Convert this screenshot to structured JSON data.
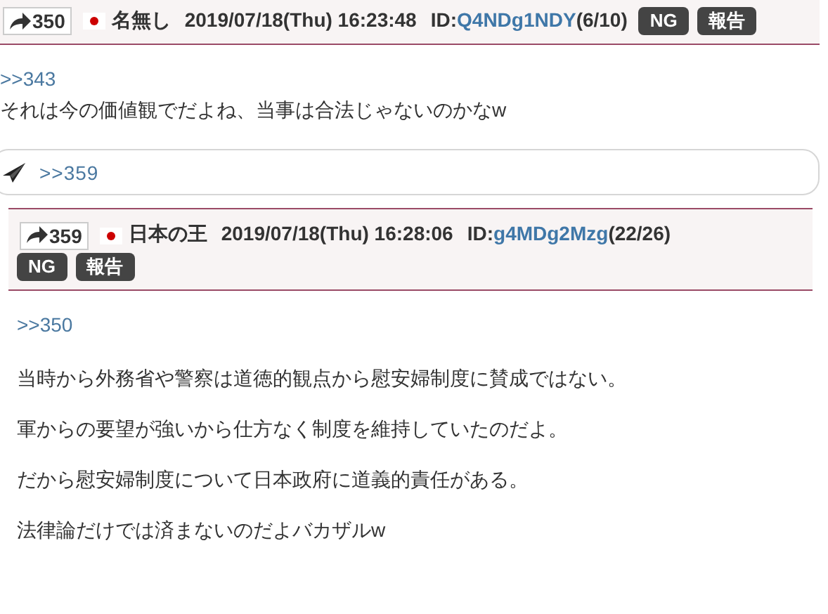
{
  "post": {
    "number": "350",
    "name": "名無し",
    "date": "2019/07/18(Thu) 16:23:48",
    "id_label": "ID:",
    "id": "Q4NDg1NDY",
    "count": "(6/10)",
    "buttons": [
      "NG",
      "報告"
    ],
    "anchor": ">>343",
    "lines": [
      "それは今の価値観でだよね、当事は合法じゃないのかなw"
    ]
  },
  "reply_box": {
    "value": ">>359"
  },
  "quoted_post": {
    "number": "359",
    "name": "日本の王",
    "date": "2019/07/18(Thu) 16:28:06",
    "id_label": "ID:",
    "id": "g4MDg2Mzg",
    "count": "(22/26)",
    "buttons": [
      "NG",
      "報告"
    ],
    "anchor": ">>350",
    "lines": [
      "当時から外務省や警察は道徳的観点から慰安婦制度に賛成ではない。",
      "軍からの要望が強いから仕方なく制度を維持していたのだよ。",
      "だから慰安婦制度について日本政府に道義的責任がある。",
      "法律論だけでは済まないのだよバカザルw"
    ]
  }
}
